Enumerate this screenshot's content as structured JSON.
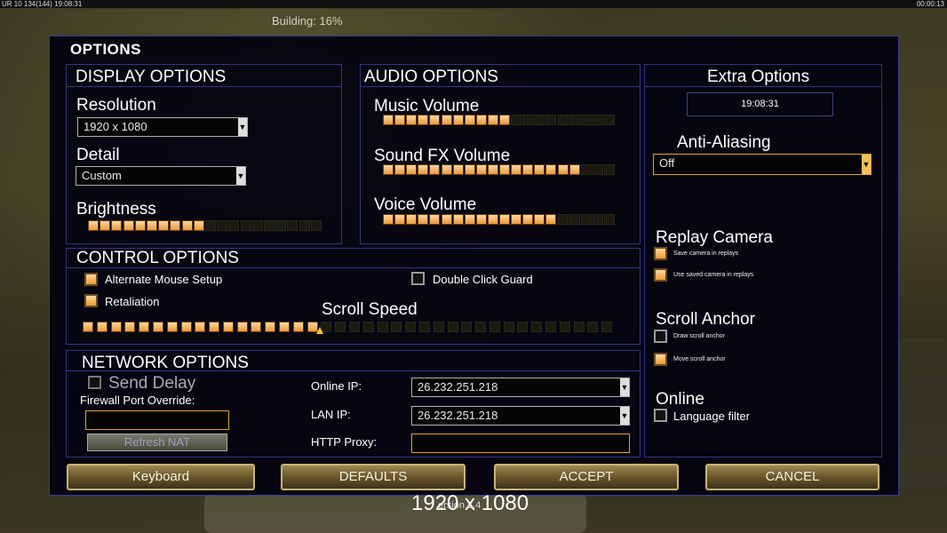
{
  "hud": {
    "top_left": "UR 10 134(144) 19:08:31",
    "top_right": "00:00:13",
    "building": "Building: 16%"
  },
  "options": {
    "title": "OPTIONS",
    "display": {
      "title": "DISPLAY OPTIONS",
      "resolution_label": "Resolution",
      "resolution_value": "1920 x 1080",
      "detail_label": "Detail",
      "detail_value": "Custom",
      "brightness_label": "Brightness",
      "brightness_level": 0.5
    },
    "audio": {
      "title": "AUDIO OPTIONS",
      "music_label": "Music Volume",
      "music_level": 0.55,
      "sfx_label": "Sound FX Volume",
      "sfx_level": 0.85,
      "voice_label": "Voice Volume",
      "voice_level": 0.75
    },
    "control": {
      "title": "CONTROL OPTIONS",
      "alt_mouse_label": "Alternate Mouse Setup",
      "alt_mouse_checked": true,
      "retaliation_label": "Retaliation",
      "retaliation_checked": true,
      "dbl_click_label": "Double Click Guard",
      "dbl_click_checked": false,
      "scroll_speed_label": "Scroll Speed",
      "scroll_speed_level": 0.45
    },
    "network": {
      "title": "NETWORK OPTIONS",
      "send_delay_label": "Send Delay",
      "send_delay_checked": false,
      "firewall_label": "Firewall Port Override:",
      "firewall_value": "",
      "refresh_label": "Refresh NAT",
      "online_ip_label": "Online IP:",
      "online_ip_value": "26.232.251.218",
      "lan_ip_label": "LAN IP:",
      "lan_ip_value": "26.232.251.218",
      "http_proxy_label": "HTTP Proxy:",
      "http_proxy_value": ""
    },
    "extra": {
      "title": "Extra Options",
      "clock": "19:08:31",
      "aa_label": "Anti-Aliasing",
      "aa_value": "Off",
      "replay_label": "Replay Camera",
      "save_camera_label": "Save camera in replays",
      "save_camera_checked": true,
      "use_camera_label": "Use saved camera in replays",
      "use_camera_checked": true,
      "scroll_anchor_label": "Scroll Anchor",
      "draw_anchor_label": "Draw scroll anchor",
      "draw_anchor_checked": false,
      "move_anchor_label": "Move scroll anchor",
      "move_anchor_checked": true,
      "online_label": "Online",
      "lang_filter_label": "Language filter",
      "lang_filter_checked": false
    },
    "buttons": {
      "keyboard": "Keyboard",
      "defaults": "DEFAULTS",
      "accept": "ACCEPT",
      "cancel": "CANCEL"
    }
  },
  "footer": {
    "resolution_overlay": "1920 x 1080",
    "version_fragment": "ersion 1.4"
  },
  "colors": {
    "accent": "#f1c15c",
    "border": "#343484",
    "panel": "#020210"
  }
}
